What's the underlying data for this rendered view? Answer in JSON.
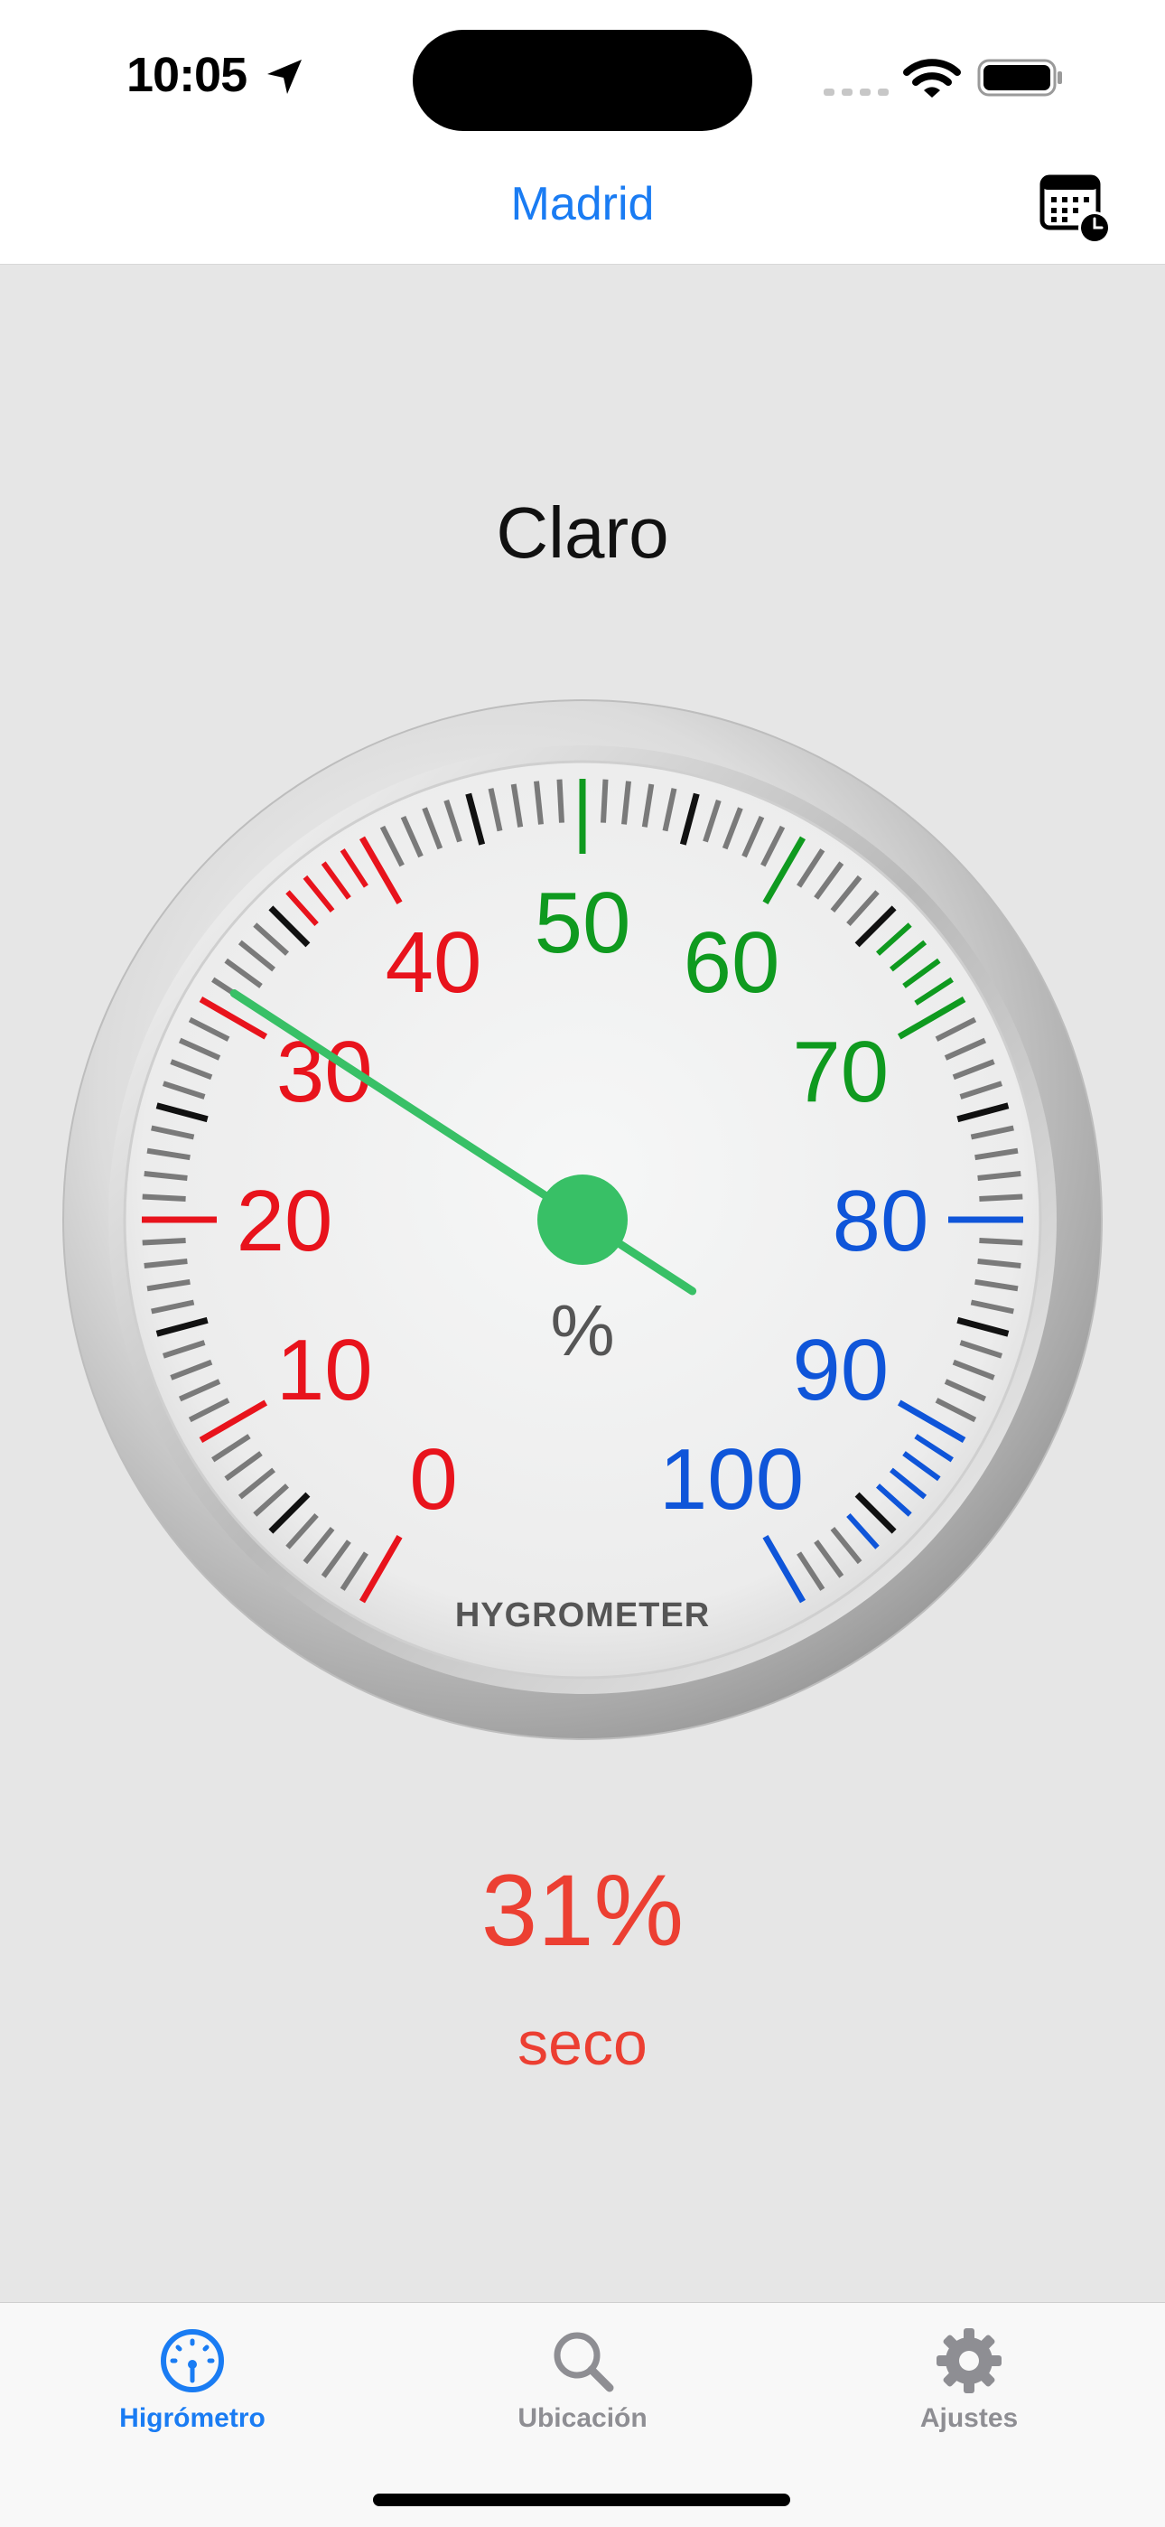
{
  "status_bar": {
    "time": "10:05"
  },
  "nav": {
    "title": "Madrid",
    "calendar_icon": "calendar-clock-icon"
  },
  "weather": {
    "condition": "Claro"
  },
  "gauge": {
    "brand": "HYGROMETER",
    "unit": "%",
    "needle_value": 31,
    "labels": [
      {
        "value": 0,
        "text": "0",
        "zone": "dry"
      },
      {
        "value": 10,
        "text": "10",
        "zone": "dry"
      },
      {
        "value": 20,
        "text": "20",
        "zone": "dry"
      },
      {
        "value": 30,
        "text": "30",
        "zone": "dry"
      },
      {
        "value": 40,
        "text": "40",
        "zone": "dry"
      },
      {
        "value": 50,
        "text": "50",
        "zone": "ok"
      },
      {
        "value": 60,
        "text": "60",
        "zone": "ok"
      },
      {
        "value": 70,
        "text": "70",
        "zone": "ok"
      },
      {
        "value": 80,
        "text": "80",
        "zone": "wet"
      },
      {
        "value": 90,
        "text": "90",
        "zone": "wet"
      },
      {
        "value": 100,
        "text": "100",
        "zone": "wet"
      }
    ],
    "colors": {
      "dry": "#e8131c",
      "ok": "#0f9a1f",
      "wet": "#0f55d9",
      "needle": "#38c066"
    }
  },
  "reading": {
    "humidity": "31%",
    "description": "seco",
    "color": "#ec3f32"
  },
  "tabs": [
    {
      "label": "Higrómetro",
      "icon": "gauge-icon",
      "selected": true
    },
    {
      "label": "Ubicación",
      "icon": "magnifying-glass-icon",
      "selected": false
    },
    {
      "label": "Ajustes",
      "icon": "gear-icon",
      "selected": false
    }
  ],
  "accent_color": "#1a7cf3"
}
